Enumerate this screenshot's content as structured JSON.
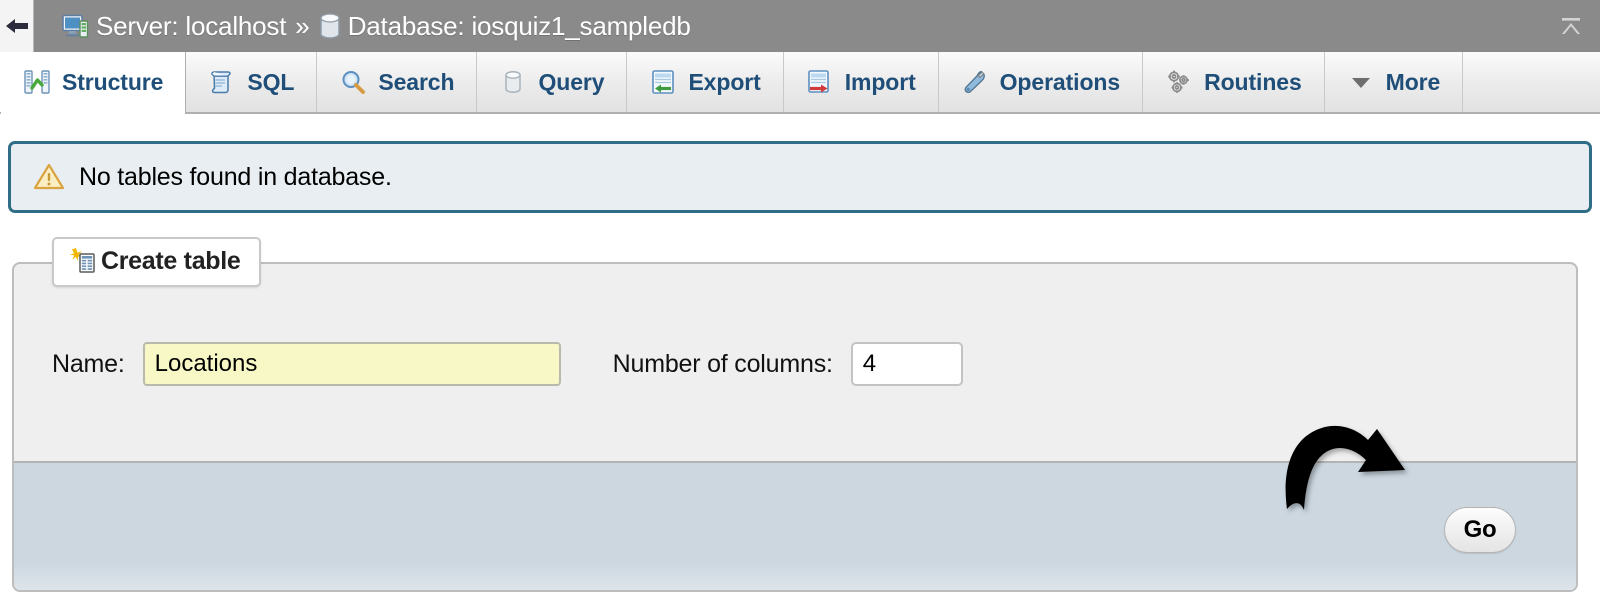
{
  "topbar": {
    "back_icon": "back-arrow-icon",
    "server_icon": "server-monitor-icon",
    "server_text": "Server: localhost",
    "separator": "»",
    "database_icon": "database-cylinder-icon",
    "database_text": "Database: iosquiz1_sampledb",
    "collapse_icon": "collapse-up-icon",
    "bar_color": "#8a8a8a"
  },
  "tabs": [
    {
      "label": "Structure",
      "icon": "structure-icon",
      "active": true
    },
    {
      "label": "SQL",
      "icon": "sql-scroll-icon",
      "active": false
    },
    {
      "label": "Search",
      "icon": "magnifier-icon",
      "active": false
    },
    {
      "label": "Query",
      "icon": "query-db-icon",
      "active": false
    },
    {
      "label": "Export",
      "icon": "export-icon",
      "active": false
    },
    {
      "label": "Import",
      "icon": "import-icon",
      "active": false
    },
    {
      "label": "Operations",
      "icon": "wrench-icon",
      "active": false
    },
    {
      "label": "Routines",
      "icon": "gears-icon",
      "active": false
    },
    {
      "label": "More",
      "icon": "chevron-down-icon",
      "active": false
    }
  ],
  "notice": {
    "icon": "warning-triangle-icon",
    "message": "No tables found in database.",
    "border_color": "#2f6e86",
    "background_color": "#e8eef1"
  },
  "create_table": {
    "legend_icon": "create-table-icon",
    "legend_label": "Create table",
    "name_label": "Name:",
    "name_value": "Locations",
    "name_placeholder": "",
    "name_field_color": "#f7f8c6",
    "columns_label": "Number of columns:",
    "columns_value": "4",
    "columns_placeholder": ""
  },
  "footer": {
    "go_label": "Go",
    "background_color": "#ccd7e0"
  },
  "annotation": {
    "arrow": "curved-black-arrow-pointing-to-go-button",
    "color": "#000000"
  }
}
